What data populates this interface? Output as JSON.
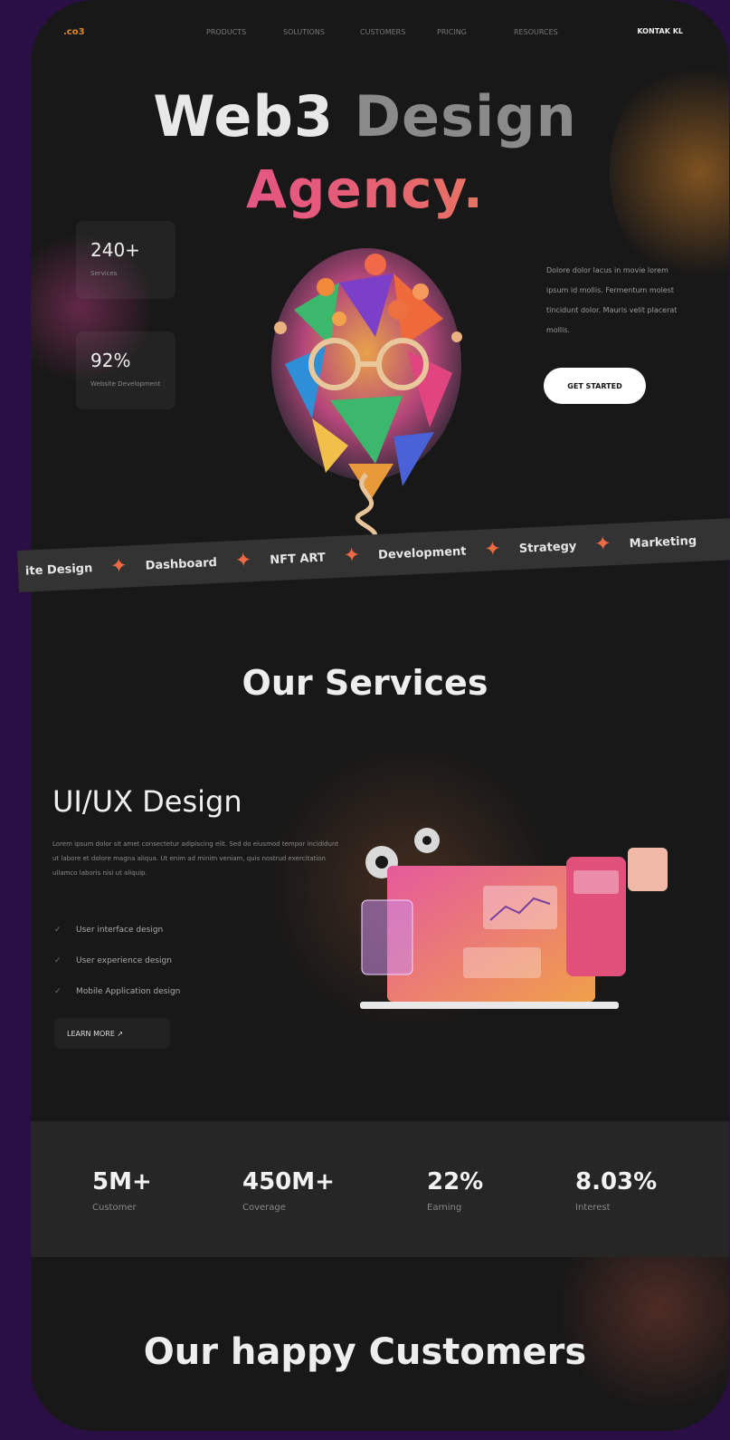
{
  "nav": {
    "logo": ".co3",
    "links": [
      "PRODUCTS",
      "SOLUTIONS",
      "CUSTOMERS",
      "PRICING",
      "RESOURCES"
    ],
    "contact": "KONTAK KL"
  },
  "hero": {
    "title_part1": "Web3",
    "title_part2": "Design",
    "title_line2": "Agency.",
    "stats": [
      {
        "value": "240+",
        "label": "Services"
      },
      {
        "value": "92%",
        "label": "Website Development"
      }
    ],
    "description": "Dolore dolor lacus in movie lorem ipsum id mollis. Fermentum molest tincidunt dolor. Mauris velit placerat mollis.",
    "cta_label": "GET STARTED"
  },
  "ticker": {
    "items": [
      "ite Design",
      "Dashboard",
      "NFT ART",
      "Development",
      "Strategy",
      "Marketing"
    ]
  },
  "services": {
    "title": "Our Services",
    "heading": "UI/UX Design",
    "description": "Lorem ipsum dolor sit amet consectetur adipiscing elit. Sed do eiusmod tempor incididunt ut labore et dolore magna aliqua. Ut enim ad minim veniam, quis nostrud exercitation ullamco laboris nisi ut aliquip.",
    "features": [
      "User interface design",
      "User experience design",
      "Mobile Application design"
    ],
    "learn_more": "LEARN MORE  ↗"
  },
  "metrics": [
    {
      "value": "5M+",
      "label": "Customer"
    },
    {
      "value": "450M+",
      "label": "Coverage"
    },
    {
      "value": "22%",
      "label": "Earning"
    },
    {
      "value": "8.03%",
      "label": "Interest"
    }
  ],
  "customers": {
    "title": "Our happy Customers"
  },
  "colors": {
    "accent_pink": "#e2499a",
    "accent_orange": "#e89a3a",
    "background": "#181818",
    "outer": "#2a0f45",
    "star": "#ee6a45"
  }
}
